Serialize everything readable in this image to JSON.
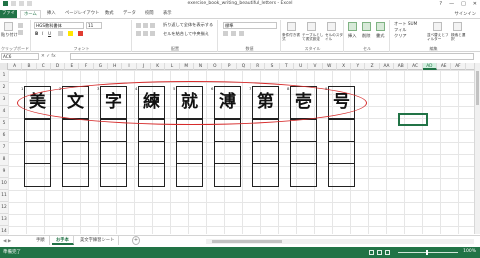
{
  "window": {
    "title": "exercise_book_writing_beautiful_letters - Excel",
    "controls": [
      "?",
      "—",
      "□",
      "✕"
    ]
  },
  "ribbon_tabs": {
    "file": "ファイル",
    "tabs": [
      "ホーム",
      "挿入",
      "ページレイアウト",
      "数式",
      "データ",
      "校閲",
      "表示"
    ],
    "signin": "サインイン"
  },
  "ribbon": {
    "clipboard": {
      "paste": "貼り付け",
      "label": "クリップボード"
    },
    "font": {
      "name": "HGS教科書体",
      "size": "11",
      "bold": "B",
      "italic": "I",
      "underline": "U",
      "label": "フォント"
    },
    "alignment": {
      "wrap": "折り返して全体を表示する",
      "merge": "セルを結合して中央揃え",
      "label": "配置"
    },
    "number": {
      "format": "標準",
      "label": "数値"
    },
    "styles": {
      "conditional": "条件付き書式",
      "table": "テーブルとして書式設定",
      "cell": "セルのスタイル",
      "label": "スタイル"
    },
    "cells": {
      "insert": "挿入",
      "delete": "削除",
      "format": "書式",
      "label": "セル"
    },
    "editing": {
      "autosum": "オート SUM",
      "fill": "フィル",
      "clear": "クリア",
      "sort": "並べ替えとフィルター",
      "find": "検索と選択",
      "label": "編集"
    }
  },
  "formula_bar": {
    "name_box": "AC6",
    "fx": "fx",
    "value": ""
  },
  "columns": [
    "A",
    "B",
    "C",
    "D",
    "E",
    "F",
    "G",
    "H",
    "I",
    "J",
    "K",
    "L",
    "M",
    "N",
    "O",
    "P",
    "Q",
    "R",
    "S",
    "T",
    "U",
    "V",
    "W",
    "X",
    "Y",
    "Z",
    "AA",
    "AB",
    "AC",
    "AD",
    "AE",
    "AF"
  ],
  "selected_column": "AD",
  "rows": [
    "1",
    "2",
    "3",
    "4",
    "5",
    "6",
    "7",
    "8",
    "9",
    "10",
    "11",
    "12",
    "13",
    "14"
  ],
  "characters": [
    {
      "index": "1",
      "char": "美"
    },
    {
      "index": "2",
      "char": "文"
    },
    {
      "index": "3",
      "char": "字"
    },
    {
      "index": "4",
      "char": "練"
    },
    {
      "index": "5",
      "char": "就"
    },
    {
      "index": "6",
      "char": "溥"
    },
    {
      "index": "7",
      "char": "第"
    },
    {
      "index": "8",
      "char": "壱"
    },
    {
      "index": "9",
      "char": "号"
    }
  ],
  "sheets": {
    "tabs": [
      "手順",
      "お手本",
      "美文字練習シート"
    ],
    "active_index": 1,
    "add": "+"
  },
  "status": {
    "text": "準備完了",
    "zoom": "100%"
  },
  "colors": {
    "accent": "#217346",
    "annotation": "#d62b2b"
  }
}
